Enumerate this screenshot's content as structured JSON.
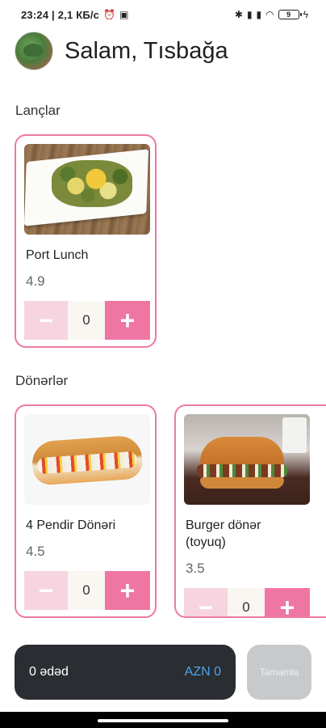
{
  "status_bar": {
    "time_speed": "23:24 | 2,1 КБ/с",
    "icons": [
      "alarm-icon",
      "app-icon",
      "bluetooth-icon",
      "signal-icon",
      "signal-icon",
      "wifi-icon",
      "battery-icon",
      "charging-icon"
    ],
    "battery_level": "9"
  },
  "header": {
    "greeting": "Salam, Tısbağa"
  },
  "sections": [
    {
      "title": "Lançlar",
      "items": [
        {
          "name": "Port Lunch",
          "rating": "4.9",
          "quantity": "0",
          "minus": "−",
          "plus": "+"
        }
      ]
    },
    {
      "title": "Dönərlər",
      "items": [
        {
          "name": "4 Pendir Dönəri",
          "rating": "4.5",
          "quantity": "0",
          "minus": "−",
          "plus": "+"
        },
        {
          "name": "Burger dönər (toyuq)",
          "rating": "3.5",
          "quantity": "0",
          "minus": "−",
          "plus": "+"
        }
      ]
    }
  ],
  "cart": {
    "count_label": "0 ədəd",
    "total_label": "AZN 0",
    "complete_label": "Tamamla"
  },
  "colors": {
    "accent_pink": "#ef75a3",
    "card_border": "#ec7aa4",
    "disabled_pink": "#f6d4e0",
    "cart_bg": "#2a2d31",
    "total_blue": "#4fa3ea",
    "button_disabled": "#c8c9cb"
  }
}
